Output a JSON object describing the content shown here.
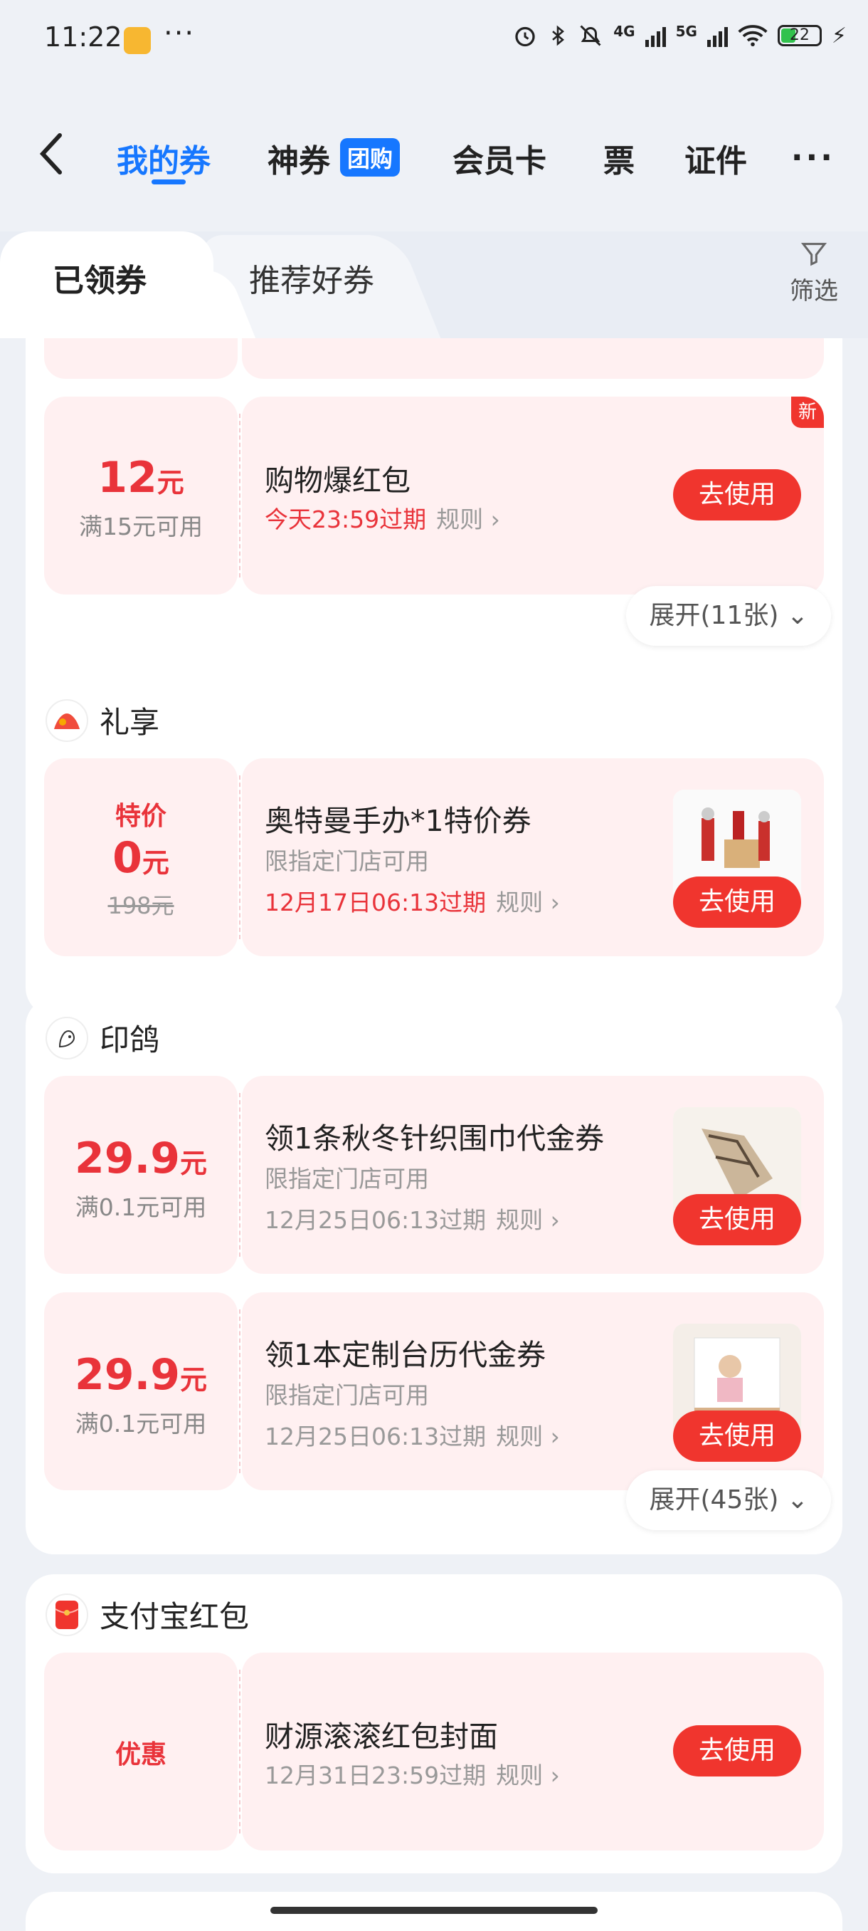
{
  "status_bar": {
    "time": "11:22",
    "dots": "···",
    "net1": "4G",
    "net2": "5G",
    "battery": "22"
  },
  "nav": {
    "tabs": [
      {
        "label": "我的券"
      },
      {
        "label": "神券"
      },
      {
        "label": "会员卡"
      },
      {
        "label": "票"
      },
      {
        "label": "证件"
      }
    ],
    "tuan_badge": "团购",
    "more": "···"
  },
  "subtabs": {
    "active": "已领券",
    "inactive": "推荐好券",
    "filter_label": "筛选"
  },
  "top_card": {
    "coupon": {
      "amount": "12",
      "unit": "元",
      "condition": "满15元可用",
      "title": "购物爆红包",
      "expiry": "今天23:59过期",
      "rule": "规则 ›",
      "button": "去使用",
      "badge": "新"
    },
    "expand": "展开(11张)"
  },
  "lixiang_card": {
    "name": "礼享",
    "coupon": {
      "tag": "特价",
      "amount": "0",
      "unit": "元",
      "original": "198元",
      "title": "奥特曼手办*1特价券",
      "limit": "限指定门店可用",
      "expiry": "12月17日06:13过期",
      "rule": "规则 ›",
      "button": "去使用"
    }
  },
  "yinge_card": {
    "name": "印鸽",
    "coupons": [
      {
        "amount": "29.9",
        "unit": "元",
        "condition": "满0.1元可用",
        "title": "领1条秋冬针织围巾代金券",
        "limit": "限指定门店可用",
        "expiry": "12月25日06:13过期",
        "rule": "规则 ›",
        "button": "去使用"
      },
      {
        "amount": "29.9",
        "unit": "元",
        "condition": "满0.1元可用",
        "title": "领1本定制台历代金券",
        "limit": "限指定门店可用",
        "expiry": "12月25日06:13过期",
        "rule": "规则 ›",
        "button": "去使用"
      }
    ],
    "expand": "展开(45张)"
  },
  "alipay_card": {
    "name": "支付宝红包",
    "coupon": {
      "tag": "优惠",
      "title": "财源滚滚红包封面",
      "expiry": "12月31日23:59过期",
      "rule": "规则 ›",
      "button": "去使用"
    }
  },
  "colors": {
    "brand_blue": "#1677ff",
    "red": "#e9333a",
    "button_red": "#f0352e",
    "coupon_bg": "#fff0f1"
  }
}
